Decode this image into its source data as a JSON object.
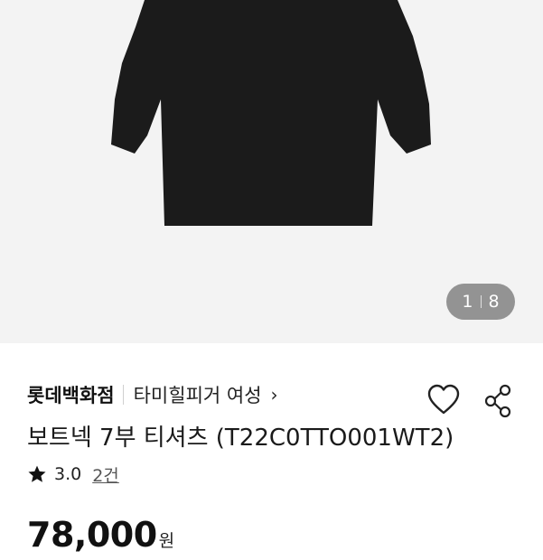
{
  "gallery": {
    "current": "1",
    "total": "8",
    "garment_color": "#1b1b1b"
  },
  "product": {
    "brand": "롯데백화점",
    "sub_brand": "타미힐피거 여성",
    "title": "보트넥 7부 티셔츠 (T22C0TTO001WT2)",
    "rating": "3.0",
    "review_count": "2건",
    "price": "78,000",
    "currency": "원"
  },
  "icons": {
    "brand_chevron": "chevron-right-icon",
    "wishlist": "heart-icon",
    "share": "share-icon",
    "rating": "star-icon"
  }
}
